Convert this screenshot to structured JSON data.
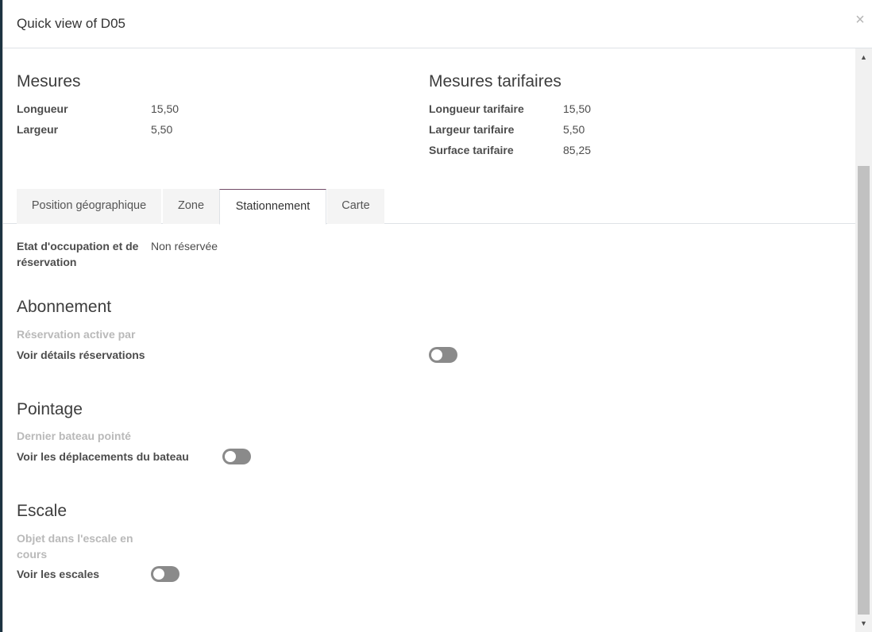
{
  "modal": {
    "title": "Quick view of D05",
    "close": "×"
  },
  "mesures": {
    "title": "Mesures",
    "fields": [
      {
        "label": "Longueur",
        "value": "15,50"
      },
      {
        "label": "Largeur",
        "value": "5,50"
      }
    ]
  },
  "mesures_tarifaires": {
    "title": "Mesures tarifaires",
    "fields": [
      {
        "label": "Longueur tarifaire",
        "value": "15,50"
      },
      {
        "label": "Largeur tarifaire",
        "value": "5,50"
      },
      {
        "label": "Surface tarifaire",
        "value": "85,25"
      }
    ]
  },
  "tabs": [
    {
      "label": "Position géographique",
      "active": false
    },
    {
      "label": "Zone",
      "active": false
    },
    {
      "label": "Stationnement",
      "active": true
    },
    {
      "label": "Carte",
      "active": false
    }
  ],
  "stationnement": {
    "etat_label_line1": "Etat d'occupation et de",
    "etat_label_line2": "réservation",
    "etat_value": "Non réservée"
  },
  "abonnement": {
    "title": "Abonnement",
    "reservation_label": "Réservation active par",
    "details_label": "Voir détails réservations",
    "details_toggle": false
  },
  "pointage": {
    "title": "Pointage",
    "dernier_label": "Dernier bateau pointé",
    "deplacements_label": "Voir les déplacements du bateau",
    "deplacements_toggle": false
  },
  "escale": {
    "title": "Escale",
    "objet_label_line1": "Objet dans l'escale en",
    "objet_label_line2": "cours",
    "escales_label": "Voir les escales",
    "escales_toggle": false
  },
  "scrollbar": {
    "up_icon": "▲",
    "down_icon": "▼"
  }
}
